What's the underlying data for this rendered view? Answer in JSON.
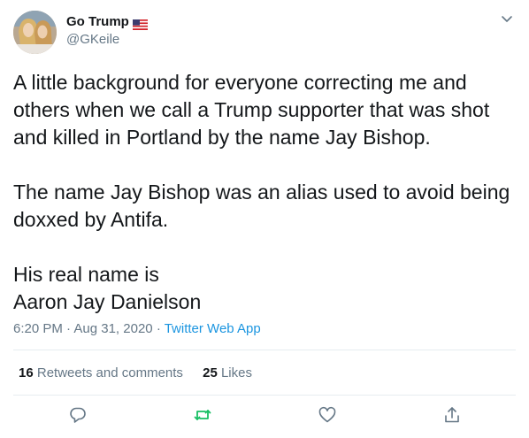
{
  "user": {
    "display_name": "Go Trump",
    "handle": "@GKeile",
    "flag_icon": "us-flag-icon",
    "avatar_icon": "profile-avatar"
  },
  "tweet": {
    "text": "A little background for everyone correcting me and\nothers when we call a Trump supporter that was shot\nand killed in Portland by the name Jay Bishop.\n\nThe name Jay Bishop was an alias used to avoid being\ndoxxed by Antifa.\n\nHis real name is\nAaron Jay Danielson"
  },
  "meta": {
    "time": "6:20 PM",
    "separator": "·",
    "date": "Aug 31, 2020",
    "source": "Twitter Web App"
  },
  "stats": {
    "retweets_count": "16",
    "retweets_label": "Retweets and comments",
    "likes_count": "25",
    "likes_label": "Likes"
  },
  "actions": {
    "reply_icon": "reply-icon",
    "retweet_icon": "retweet-icon",
    "like_icon": "heart-icon",
    "share_icon": "share-icon"
  },
  "colors": {
    "text": "#14171a",
    "secondary": "#657786",
    "link": "#1b95e0",
    "retweet": "#17bf63",
    "divider": "#e6ecf0"
  }
}
